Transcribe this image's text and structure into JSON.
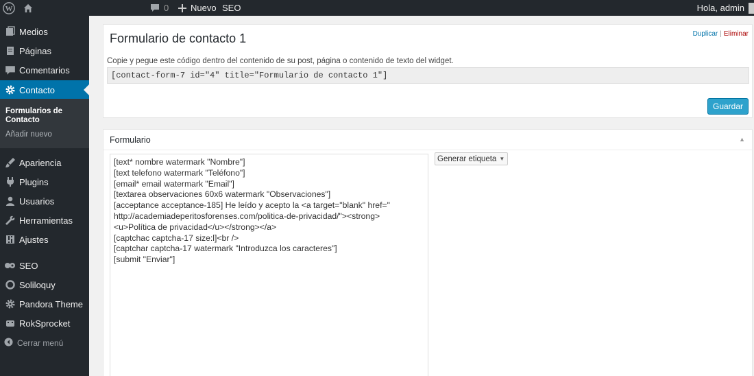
{
  "adminbar": {
    "comments_count": "0",
    "new_label": "Nuevo",
    "seo_label": "SEO",
    "greeting": "Hola, admin",
    "icons": [
      "wordpress-logo-icon",
      "home-icon",
      "comment-icon",
      "plus-icon"
    ]
  },
  "sidebar": {
    "items": [
      {
        "label": "Medios",
        "icon": "media-icon"
      },
      {
        "label": "Páginas",
        "icon": "pages-icon"
      },
      {
        "label": "Comentarios",
        "icon": "comments-icon"
      },
      {
        "label": "Contacto",
        "icon": "gear-icon",
        "current": true
      },
      {
        "label": "Apariencia",
        "icon": "brush-icon"
      },
      {
        "label": "Plugins",
        "icon": "plug-icon"
      },
      {
        "label": "Usuarios",
        "icon": "user-icon"
      },
      {
        "label": "Herramientas",
        "icon": "wrench-icon"
      },
      {
        "label": "Ajustes",
        "icon": "settings-icon"
      },
      {
        "label": "SEO",
        "icon": "seo-icon"
      },
      {
        "label": "Soliloquy",
        "icon": "soliloquy-icon"
      },
      {
        "label": "Pandora Theme",
        "icon": "theme-gear-icon"
      },
      {
        "label": "RokSprocket",
        "icon": "sprocket-icon"
      }
    ],
    "submenu": [
      {
        "label": "Formularios de Contacto",
        "active": true
      },
      {
        "label": "Añadir nuevo",
        "active": false
      }
    ],
    "collapse_label": "Cerrar menú"
  },
  "form_box": {
    "title": "Formulario de contacto 1",
    "duplicate_label": "Duplicar",
    "separator": "|",
    "delete_label": "Eliminar",
    "hint": "Copie y pegue este código dentro del contenido de su post, página o contenido de texto del widget.",
    "shortcode": "[contact-form-7 id=\"4\" title=\"Formulario de contacto 1\"]",
    "save_label": "Guardar"
  },
  "editor_box": {
    "title": "Formulario",
    "generate_tag_label": "Generar etiqueta",
    "lines": [
      "[text* nombre watermark \"Nombre\"]",
      "[text telefono watermark \"Teléfono\"]",
      "[email* email watermark \"Email\"]",
      "[textarea observaciones 60x6 watermark \"Observaciones\"]",
      "[acceptance acceptance-185] He leído y acepto la <a target=\"blank\" href=\"",
      "http://academiadeperitosforenses.com/politica-de-privacidad/\"><strong>",
      "<u>Política de privacidad</u></strong></a>",
      "[captchac captcha-17 size:l]<br />",
      "[captchar captcha-17 watermark \"Introduzca los caracteres\"]",
      "[submit \"Enviar\"]"
    ]
  },
  "colors": {
    "adminbar_bg": "#23282d",
    "menu_current": "#0073aa",
    "button_primary": "#2ea2cc",
    "delete_link": "#aa0000"
  }
}
